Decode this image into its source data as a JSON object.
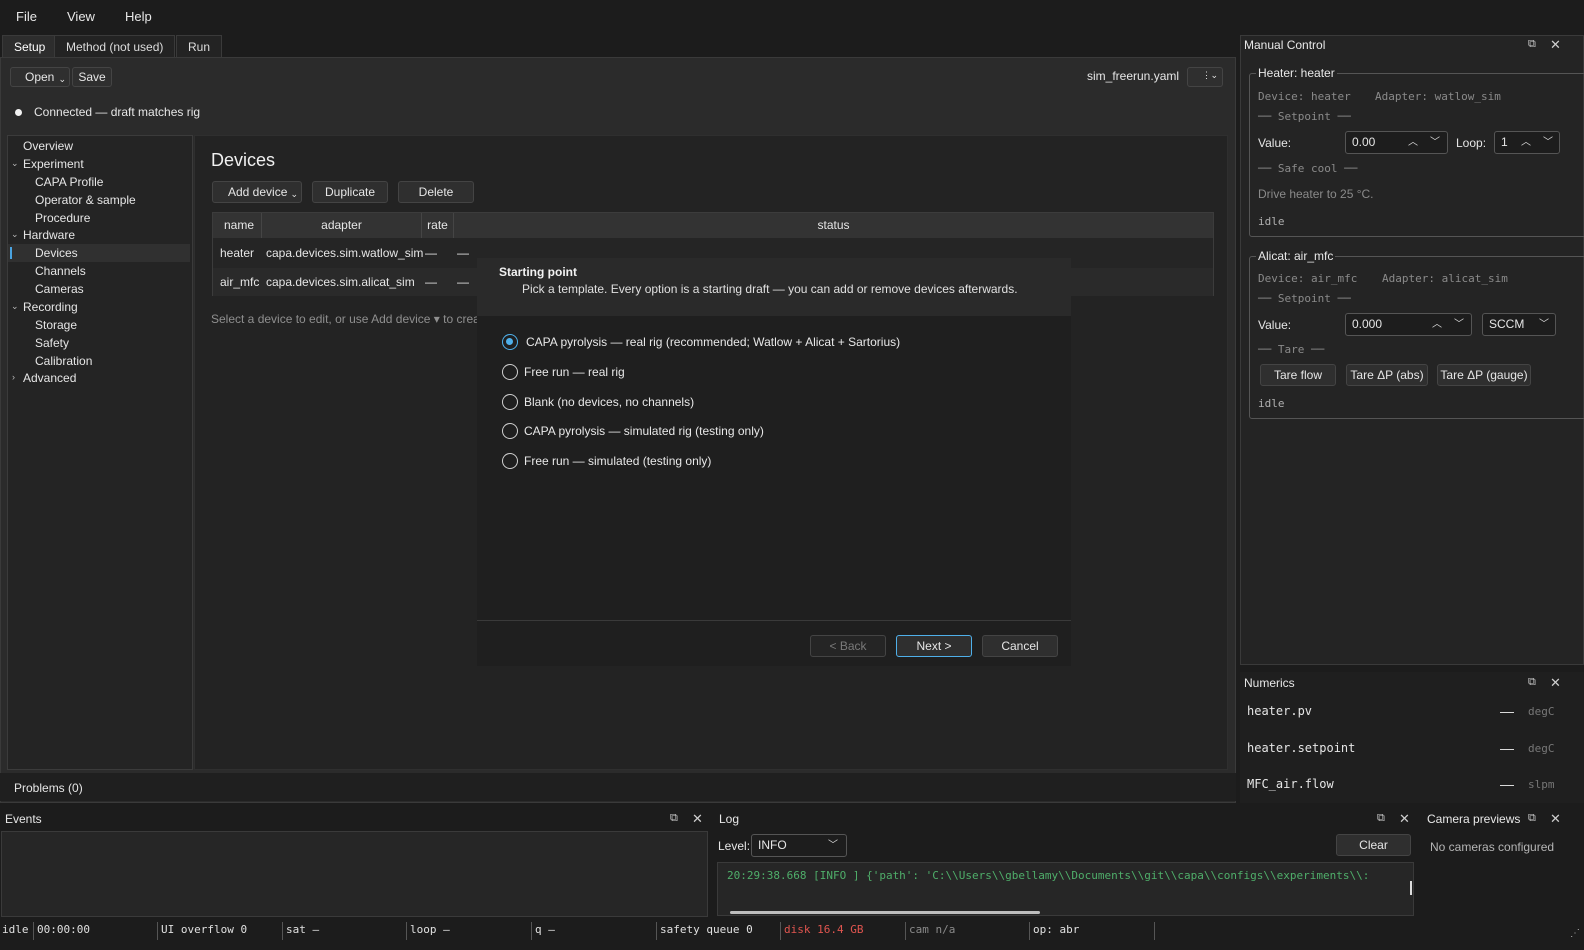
{
  "menubar": {
    "file": "File",
    "view": "View",
    "help": "Help"
  },
  "tabs": {
    "setup": "Setup",
    "method": "Method (not used)",
    "run": "Run"
  },
  "toolbar": {
    "open": "Open",
    "save": "Save",
    "config_file": "sim_freerun.yaml"
  },
  "connection": {
    "status": "Connected — draft matches rig"
  },
  "tree": {
    "overview": "Overview",
    "experiment": "Experiment",
    "capa_profile": "CAPA Profile",
    "operator_sample": "Operator & sample",
    "procedure": "Procedure",
    "hardware": "Hardware",
    "devices": "Devices",
    "channels": "Channels",
    "cameras": "Cameras",
    "recording": "Recording",
    "storage": "Storage",
    "safety": "Safety",
    "calibration": "Calibration",
    "advanced": "Advanced"
  },
  "devices": {
    "title": "Devices",
    "add": "Add device",
    "duplicate": "Duplicate",
    "delete": "Delete",
    "columns": {
      "name": "name",
      "adapter": "adapter",
      "rate": "rate",
      "status": "status"
    },
    "rows": [
      {
        "name": "heater",
        "adapter": "capa.devices.sim.watlow_sim",
        "rate": "—",
        "status": "—"
      },
      {
        "name": "air_mfc",
        "adapter": "capa.devices.sim.alicat_sim",
        "rate": "—",
        "status": "—"
      }
    ],
    "hint": "Select a device to edit, or use Add device ▾ to create"
  },
  "wizard": {
    "title": "Starting point",
    "subtitle": "Pick a template. Every option is a starting draft — you can add or remove devices afterwards.",
    "options": [
      "CAPA pyrolysis — real rig (recommended; Watlow + Alicat + Sartorius)",
      "Free run — real rig",
      "Blank (no devices, no channels)",
      "CAPA pyrolysis — simulated rig (testing only)",
      "Free run — simulated (testing only)"
    ],
    "back": "< Back",
    "next": "Next >",
    "cancel": "Cancel"
  },
  "problems": {
    "label": "Problems (0)"
  },
  "manual_control": {
    "title": "Manual Control",
    "heater": {
      "group": "Heater: heater",
      "device": "Device: heater",
      "adapter": "Adapter: watlow_sim",
      "setpoint_header": "── Setpoint ──",
      "value_label": "Value:",
      "value": "0.00",
      "loop_label": "Loop:",
      "loop": "1",
      "safe_cool_header": "── Safe cool ──",
      "safe_cool_text": "Drive heater to 25 °C.",
      "state": "idle"
    },
    "alicat": {
      "group": "Alicat: air_mfc",
      "device": "Device: air_mfc",
      "adapter": "Adapter: alicat_sim",
      "setpoint_header": "── Setpoint ──",
      "value_label": "Value:",
      "value": "0.000",
      "unit": "SCCM",
      "tare_header": "── Tare ──",
      "tare_flow": "Tare flow",
      "tare_abs": "Tare ΔP (abs)",
      "tare_gauge": "Tare ΔP (gauge)",
      "state": "idle"
    }
  },
  "numerics": {
    "title": "Numerics",
    "rows": [
      {
        "name": "heater.pv",
        "value": "—",
        "unit": "degC"
      },
      {
        "name": "heater.setpoint",
        "value": "—",
        "unit": "degC"
      },
      {
        "name": "MFC_air.flow",
        "value": "—",
        "unit": "slpm"
      }
    ]
  },
  "events": {
    "title": "Events"
  },
  "log": {
    "title": "Log",
    "level_label": "Level:",
    "level": "INFO",
    "clear": "Clear",
    "line": "20:29:38.668  [INFO ] {'path': 'C:\\\\Users\\\\gbellamy\\\\Documents\\\\git\\\\capa\\\\configs\\\\experiments\\\\:"
  },
  "cameras": {
    "title": "Camera previews",
    "empty": "No cameras configured"
  },
  "statusbar": {
    "state": "idle",
    "time": "00:00:00",
    "ui_overflow": "UI overflow 0",
    "sat": "sat —",
    "loop": "loop —",
    "q": "q —",
    "safety_queue": "safety queue 0",
    "disk": "disk 16.4 GB",
    "cam": "cam n/a",
    "op": "op: abr"
  },
  "colors": {
    "accent": "#4fb0ea",
    "disk_warning": "#e0554f",
    "log_text": "#4fae6a"
  }
}
